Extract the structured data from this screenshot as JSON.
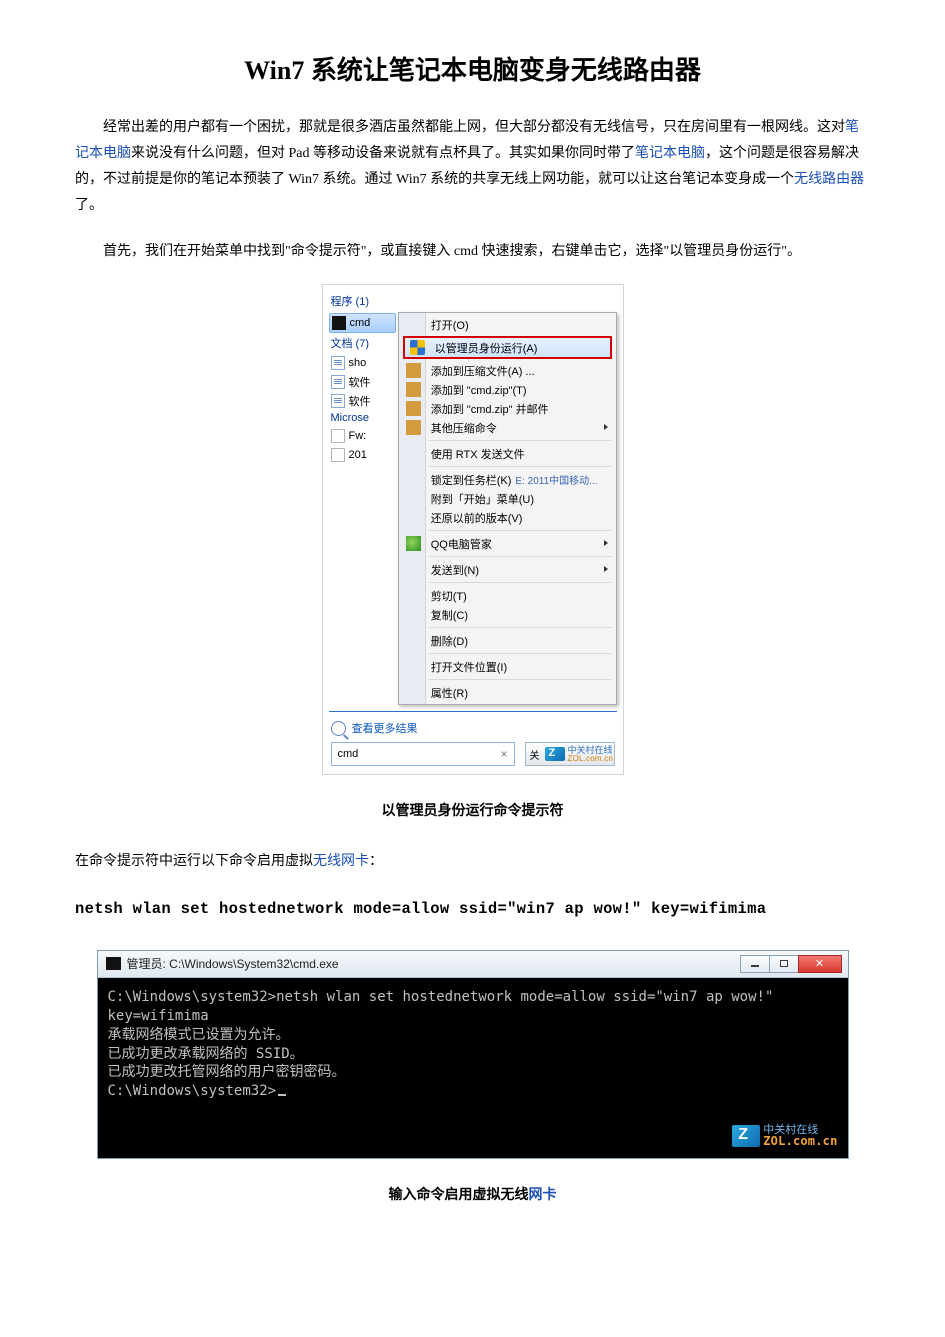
{
  "title": "Win7 系统让笔记本电脑变身无线路由器",
  "para1": {
    "t1": "经常出差的用户都有一个困扰，那就是很多酒店虽然都能上网，但大部分都没有无线信号，只在房间里有一根网线。这对",
    "link1": "笔记本电脑",
    "t2": "来说没有什么问题，但对 Pad 等移动设备来说就有点杯具了。其实如果你同时带了",
    "link2": "笔记本电脑",
    "t3": "，这个问题是很容易解决的，不过前提是你的笔记本预装了 Win7 系统。通过 Win7 系统的共享无线上网功能，就可以让这台笔记本变身成一个",
    "link3": "无线路由器",
    "t4": "了。"
  },
  "para2": "首先，我们在开始菜单中找到\"命令提示符\"，或直接键入 cmd 快速搜索，右键单击它，选择\"以管理员身份运行\"。",
  "shot1": {
    "sec_programs": "程序 (1)",
    "cmd_item": "cmd",
    "sec_docs": "文档 (7)",
    "doc1": "sho",
    "doc2": "软件",
    "doc3": "软件",
    "sec_ms": "Microse",
    "ms1": "Fw:",
    "ms2": "201",
    "side_note": "E: 2011中国移动...",
    "menu": {
      "open": "打开(O)",
      "admin": "以管理员身份运行(A)",
      "addzip": "添加到压缩文件(A) ...",
      "addcmdzip": "添加到 \"cmd.zip\"(T)",
      "addmail": "添加到 \"cmd.zip\" 并邮件",
      "othercomp": "其他压缩命令",
      "rtx": "使用 RTX 发送文件",
      "pin": "锁定到任务栏(K)",
      "pinstart": "附到「开始」菜单(U)",
      "restore": "还原以前的版本(V)",
      "qq": "QQ电脑管家",
      "sendto": "发送到(N)",
      "cut": "剪切(T)",
      "copy": "复制(C)",
      "delete": "删除(D)",
      "openloc": "打开文件位置(I)",
      "prop": "属性(R)"
    },
    "more_results": "查看更多结果",
    "search_value": "cmd",
    "search_clear": "×",
    "shutdown_prefix": "关",
    "zol_cn": "中关村在线",
    "zol_url": "ZOL.com.cn"
  },
  "caption1": "以管理员身份运行命令提示符",
  "para3": {
    "t1": "在命令提示符中运行以下命令启用虚拟",
    "link1": "无线网卡",
    "t2": "："
  },
  "command_line": "netsh wlan set hostednetwork mode=allow ssid=\"win7 ap wow!\" key=wifimima",
  "shot2": {
    "title": "管理员: C:\\Windows\\System32\\cmd.exe",
    "line1": "C:\\Windows\\system32>netsh wlan set hostednetwork mode=allow ssid=\"win7 ap wow!\"",
    "line2": " key=wifimima",
    "line3": "承载网络模式已设置为允许。",
    "line4": "已成功更改承载网络的 SSID。",
    "line5": "已成功更改托管网络的用户密钥密码。",
    "line6": "",
    "prompt": "C:\\Windows\\system32>",
    "zol_cn": "中关村在线",
    "zol_url": "ZOL.com.cn"
  },
  "caption2_a": "输入命令启用虚拟无线",
  "caption2_link": "网卡"
}
